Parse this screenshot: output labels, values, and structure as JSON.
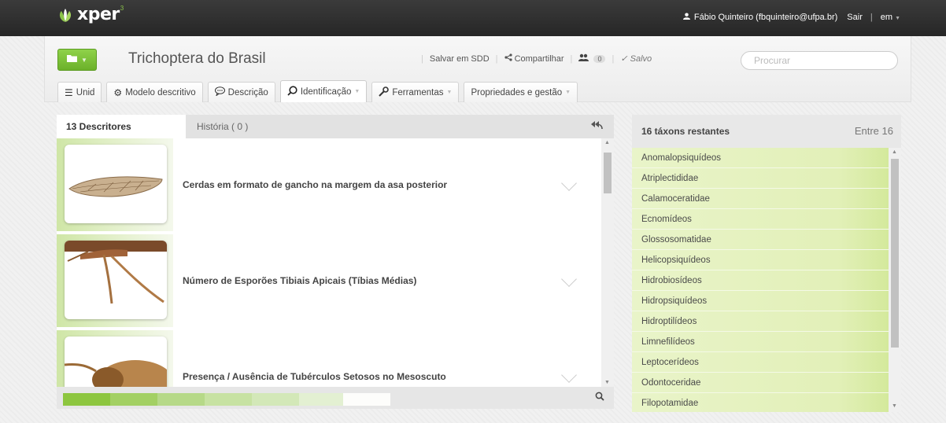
{
  "topbar": {
    "logo_text": "xper",
    "logo_sup": "3",
    "user_label": "Fábio Quinteiro (fbquinteiro@ufpa.br)",
    "logout_label": "Sair",
    "language_label": "em"
  },
  "header": {
    "project_title": "Trichoptera do Brasil",
    "save_sdd_label": "Salvar em SDD",
    "share_label": "Compartilhar",
    "users_count": "0",
    "saved_label": "Salvo",
    "search_placeholder": "Procurar"
  },
  "tabs": [
    {
      "label": "Unid"
    },
    {
      "label": "Modelo descritivo"
    },
    {
      "label": "Descrição"
    },
    {
      "label": "Identificação"
    },
    {
      "label": "Ferramentas"
    },
    {
      "label": "Propriedades e gestão"
    }
  ],
  "descriptors_panel": {
    "tab_descriptors": "13 Descritores",
    "tab_history": "História ( 0 )",
    "items": [
      {
        "label": "Cerdas em formato de gancho na margem da asa posterior"
      },
      {
        "label": "Número de Esporões Tibiais Apicais (Tíbias Médias)"
      },
      {
        "label": "Presença / Ausência de Tubérculos Setosos no Mesoscuto"
      }
    ],
    "progress_colors": [
      "#8dc63f",
      "#a3d063",
      "#b6d988",
      "#c7e2a2",
      "#d3e8b8",
      "#e3f0d2",
      "#fdfdfb"
    ]
  },
  "taxa_panel": {
    "title": "16 táxons restantes",
    "count_label": "Entre 16",
    "items": [
      "Anomalopsiquídeos",
      "Atriplectididae",
      "Calamoceratidae",
      "Ecnomídeos",
      "Glossosomatidae",
      "Helicopsiquídeos",
      "Hidrobiosídeos",
      "Hidropsiquídeos",
      "Hidroptilídeos",
      "Limnefilídeos",
      "Leptocerídeos",
      "Odontoceridae",
      "Filopotamidae"
    ]
  }
}
